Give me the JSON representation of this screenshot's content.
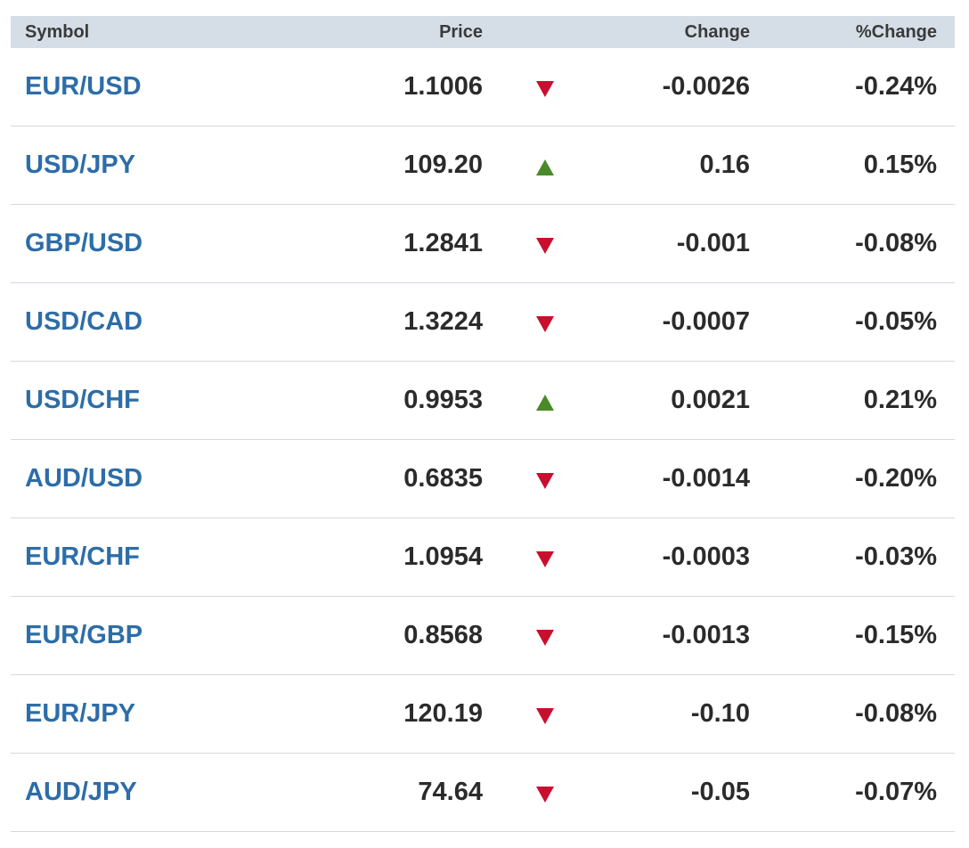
{
  "headers": {
    "symbol": "Symbol",
    "price": "Price",
    "change": "Change",
    "pct_change": "%Change"
  },
  "colors": {
    "header_bg": "#d5dee7",
    "symbol_link": "#2d6da8",
    "down": "#c8102e",
    "up": "#4a8a2a"
  },
  "rows": [
    {
      "symbol": "EUR/USD",
      "price": "1.1006",
      "direction": "down",
      "change": "-0.0026",
      "pct_change": "-0.24%"
    },
    {
      "symbol": "USD/JPY",
      "price": "109.20",
      "direction": "up",
      "change": "0.16",
      "pct_change": "0.15%"
    },
    {
      "symbol": "GBP/USD",
      "price": "1.2841",
      "direction": "down",
      "change": "-0.001",
      "pct_change": "-0.08%"
    },
    {
      "symbol": "USD/CAD",
      "price": "1.3224",
      "direction": "down",
      "change": "-0.0007",
      "pct_change": "-0.05%"
    },
    {
      "symbol": "USD/CHF",
      "price": "0.9953",
      "direction": "up",
      "change": "0.0021",
      "pct_change": "0.21%"
    },
    {
      "symbol": "AUD/USD",
      "price": "0.6835",
      "direction": "down",
      "change": "-0.0014",
      "pct_change": "-0.20%"
    },
    {
      "symbol": "EUR/CHF",
      "price": "1.0954",
      "direction": "down",
      "change": "-0.0003",
      "pct_change": "-0.03%"
    },
    {
      "symbol": "EUR/GBP",
      "price": "0.8568",
      "direction": "down",
      "change": "-0.0013",
      "pct_change": "-0.15%"
    },
    {
      "symbol": "EUR/JPY",
      "price": "120.19",
      "direction": "down",
      "change": "-0.10",
      "pct_change": "-0.08%"
    },
    {
      "symbol": "AUD/JPY",
      "price": "74.64",
      "direction": "down",
      "change": "-0.05",
      "pct_change": "-0.07%"
    }
  ]
}
